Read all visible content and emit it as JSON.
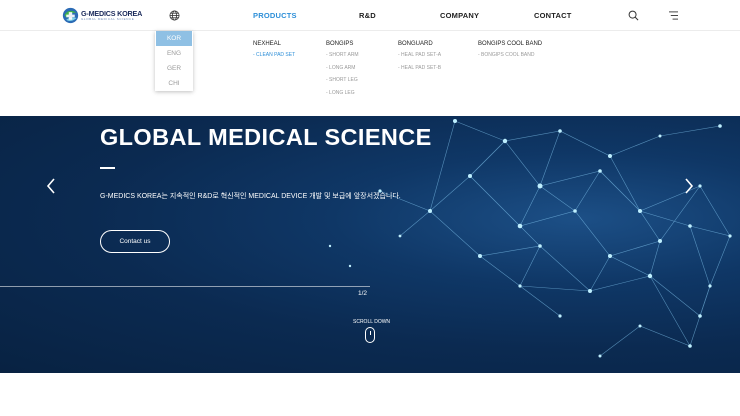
{
  "header": {
    "logo_title": "G-MEDICS KOREA",
    "logo_subtitle": "GLOBAL MEDICAL SCIENCE",
    "nav": [
      "PRODUCTS",
      "R&D",
      "COMPANY",
      "CONTACT"
    ],
    "active_nav": "PRODUCTS",
    "icons": [
      "globe-icon",
      "search-icon",
      "menu-icon"
    ]
  },
  "language_menu": {
    "items": [
      "KOR",
      "ENG",
      "GER",
      "CHI"
    ],
    "selected": "KOR"
  },
  "mega_menu": {
    "columns": [
      {
        "title": "NEXHEAL",
        "items": [
          "- CLEAN PAD SET"
        ]
      },
      {
        "title": "BONGIPS",
        "items": [
          "- SHORT ARM",
          "- LONG ARM",
          "- SHORT LEG",
          "- LONG LEG"
        ]
      },
      {
        "title": "BONGUARD",
        "items": [
          "- HEAL PAD SET-A",
          "- HEAL PAD SET-B"
        ]
      },
      {
        "title": "BONGIPS COOL BAND",
        "items": [
          "- BONGIPS COOL BAND"
        ]
      }
    ]
  },
  "hero": {
    "title": "GLOBAL MEDICAL SCIENCE",
    "description": "G-MEDICS KOREA는 지속적인 R&D로 혁신적인 MEDICAL DEVICE 개발 및 보급에 앞장서겠습니다.",
    "button": "Contact us",
    "pager": "1/2",
    "scroll_label": "SCROLL DOWN"
  },
  "colors": {
    "accent": "#2e8fd8",
    "selected_language_bg": "#8fc0e4",
    "hero_bg": "#0b2a51"
  }
}
